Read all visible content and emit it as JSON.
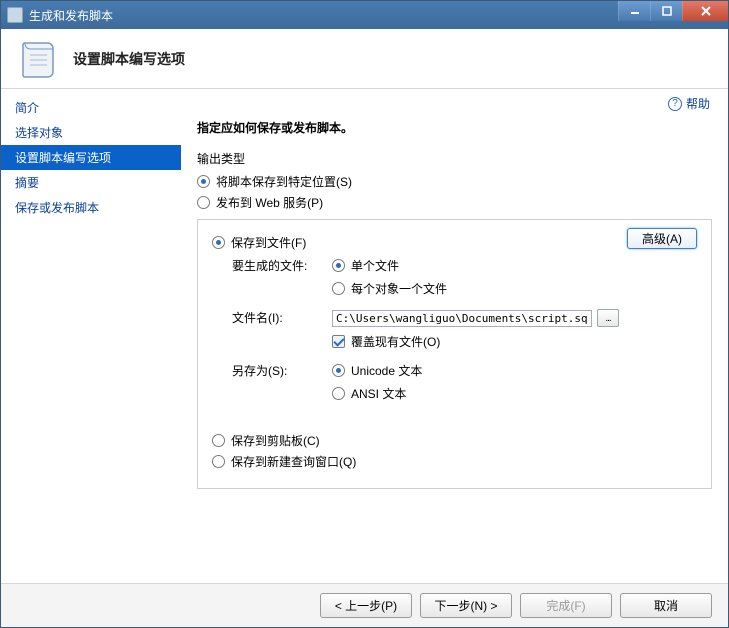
{
  "window": {
    "title": "生成和发布脚本"
  },
  "header": {
    "title": "设置脚本编写选项"
  },
  "help": {
    "label": "帮助"
  },
  "sidebar": {
    "items": [
      {
        "label": "简介"
      },
      {
        "label": "选择对象"
      },
      {
        "label": "设置脚本编写选项"
      },
      {
        "label": "摘要"
      },
      {
        "label": "保存或发布脚本"
      }
    ],
    "selected_index": 2
  },
  "main": {
    "heading": "指定应如何保存或发布脚本。",
    "output_type": {
      "label": "输出类型",
      "options": [
        {
          "label": "将脚本保存到特定位置(S)",
          "selected": true
        },
        {
          "label": "发布到 Web 服务(P)",
          "selected": false
        }
      ]
    },
    "save_panel": {
      "save_to_file": {
        "label": "保存到文件(F)",
        "selected": true
      },
      "advanced_button": "高级(A)",
      "files_to_generate": {
        "label": "要生成的文件:",
        "options": [
          {
            "label": "单个文件",
            "selected": true
          },
          {
            "label": "每个对象一个文件",
            "selected": false
          }
        ]
      },
      "filename": {
        "label": "文件名(I):",
        "value": "C:\\Users\\wangliguo\\Documents\\script.sql"
      },
      "overwrite": {
        "label": "覆盖现有文件(O)",
        "checked": true
      },
      "save_as": {
        "label": "另存为(S):",
        "options": [
          {
            "label": "Unicode 文本",
            "selected": true
          },
          {
            "label": "ANSI 文本",
            "selected": false
          }
        ]
      },
      "save_to_clipboard": {
        "label": "保存到剪贴板(C)",
        "selected": false
      },
      "save_to_new_query": {
        "label": "保存到新建查询窗口(Q)",
        "selected": false
      }
    }
  },
  "footer": {
    "prev": "< 上一步(P)",
    "next": "下一步(N) >",
    "finish": "完成(F)",
    "cancel": "取消"
  }
}
